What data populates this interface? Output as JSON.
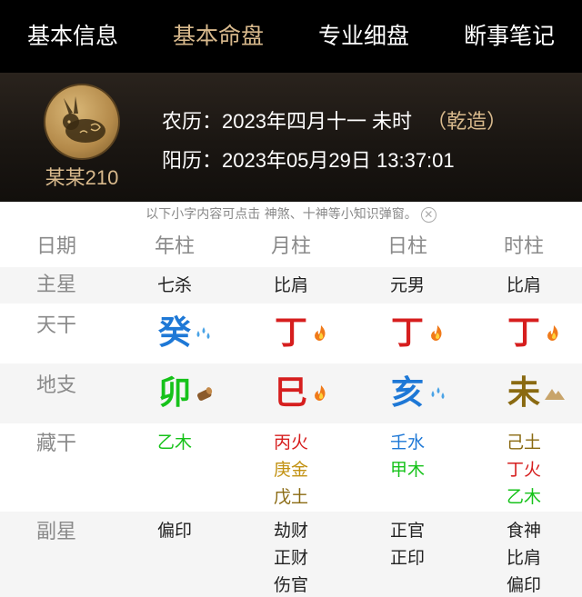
{
  "tabs": [
    {
      "label": "基本信息",
      "active": false
    },
    {
      "label": "基本命盘",
      "active": true
    },
    {
      "label": "专业细盘",
      "active": false
    },
    {
      "label": "断事笔记",
      "active": false
    }
  ],
  "header": {
    "avatar_icon": "rabbit-zodiac-icon",
    "name": "某某210",
    "lunar": "农历：2023年四月十一 未时",
    "qianzao": "（乾造）",
    "solar": "阳历：2023年05月29日 13:37:01"
  },
  "tip": {
    "text": "以下小字内容可点击 神煞、十神等小知识弹窗。",
    "close_icon": "close-circle-icon"
  },
  "table": {
    "headers": [
      "日期",
      "年柱",
      "月柱",
      "日柱",
      "时柱"
    ],
    "zhuxing": {
      "label": "主星",
      "values": [
        "七杀",
        "比肩",
        "元男",
        "比肩"
      ]
    },
    "tiangan": {
      "label": "天干",
      "values": [
        "癸",
        "丁",
        "丁",
        "丁"
      ],
      "icons": [
        "water-drops-icon",
        "fire-icon",
        "fire-icon",
        "fire-icon"
      ]
    },
    "dizhi": {
      "label": "地支",
      "values": [
        "卯",
        "巳",
        "亥",
        "未"
      ],
      "icons": [
        "wood-log-icon",
        "fire-icon",
        "water-drops-icon",
        "earth-mound-icon"
      ]
    },
    "canggan": {
      "label": "藏干",
      "values": [
        [
          "乙木"
        ],
        [
          "丙火",
          "庚金",
          "戊土"
        ],
        [
          "壬水",
          "甲木"
        ],
        [
          "己土",
          "丁火",
          "乙木"
        ]
      ]
    },
    "fuxing": {
      "label": "副星",
      "values": [
        [
          "偏印"
        ],
        [
          "劫财",
          "正财",
          "伤官"
        ],
        [
          "正官",
          "正印"
        ],
        [
          "食神",
          "比肩",
          "偏印"
        ]
      ]
    }
  },
  "colors": {
    "wood": "#16c21a",
    "fire": "#d61e1e",
    "water": "#1e78d6",
    "earth": "#8a6a12",
    "metal": "#c29213",
    "gold_accent": "#d8b98c"
  }
}
